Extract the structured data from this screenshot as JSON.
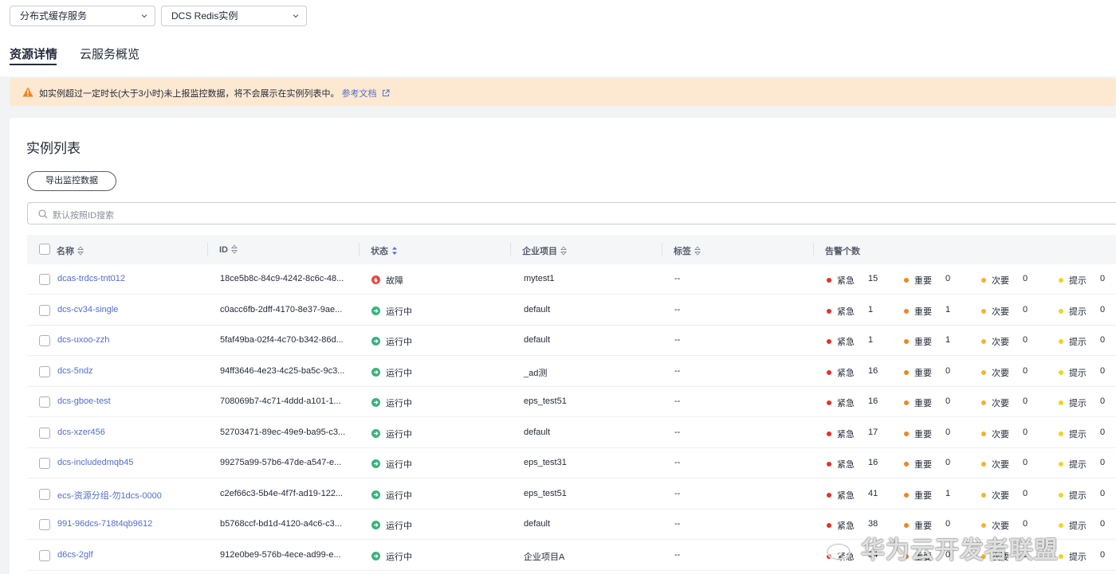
{
  "filters": {
    "service": "分布式缓存服务",
    "resource_type": "DCS Redis实例"
  },
  "tabs": [
    {
      "label": "资源详情",
      "active": true
    },
    {
      "label": "云服务概览",
      "active": false
    }
  ],
  "notice": {
    "text": "如实例超过一定时长(大于3小时)未上报监控数据，将不会展示在实例列表中。",
    "link": "参考文档"
  },
  "panel": {
    "title": "实例列表",
    "export_button": "导出监控数据",
    "search_placeholder": "默认按照ID搜索"
  },
  "table": {
    "columns": {
      "name": "名称",
      "id": "ID",
      "status": "状态",
      "project": "企业项目",
      "tags": "标签",
      "alarms": "告警个数"
    },
    "alarm_labels": {
      "critical": "紧急",
      "major": "重要",
      "minor": "次要",
      "info": "提示"
    },
    "rows": [
      {
        "name": "dcas-trdcs-tnt012",
        "id": "18ce5b8c-84c9-4242-8c6c-48...",
        "status": "故障",
        "status_kind": "fault",
        "project": "mytest1",
        "tags": "--",
        "critical": "15",
        "major": "0",
        "minor": "0",
        "info": "0"
      },
      {
        "name": "dcs-cv34-single",
        "id": "c0acc6fb-2dff-4170-8e37-9ae...",
        "status": "运行中",
        "status_kind": "running",
        "project": "default",
        "tags": "--",
        "critical": "1",
        "major": "1",
        "minor": "0",
        "info": "0"
      },
      {
        "name": "dcs-uxoo-zzh",
        "id": "5faf49ba-02f4-4c70-b342-86d...",
        "status": "运行中",
        "status_kind": "running",
        "project": "default",
        "tags": "--",
        "critical": "1",
        "major": "1",
        "minor": "0",
        "info": "0"
      },
      {
        "name": "dcs-5ndz",
        "id": "94ff3646-4e23-4c25-ba5c-9c3...",
        "status": "运行中",
        "status_kind": "running",
        "project": "_ad测",
        "tags": "--",
        "critical": "16",
        "major": "0",
        "minor": "0",
        "info": "0"
      },
      {
        "name": "dcs-gboe-test",
        "id": "708069b7-4c71-4ddd-a101-1...",
        "status": "运行中",
        "status_kind": "running",
        "project": "eps_test51",
        "tags": "--",
        "critical": "16",
        "major": "0",
        "minor": "0",
        "info": "0"
      },
      {
        "name": "dcs-xzer456",
        "id": "52703471-89ec-49e9-ba95-c3...",
        "status": "运行中",
        "status_kind": "running",
        "project": "default",
        "tags": "--",
        "critical": "17",
        "major": "0",
        "minor": "0",
        "info": "0"
      },
      {
        "name": "dcs-includedmqb45",
        "id": "99275a99-57b6-47de-a547-e...",
        "status": "运行中",
        "status_kind": "running",
        "project": "eps_test31",
        "tags": "--",
        "critical": "16",
        "major": "0",
        "minor": "0",
        "info": "0"
      },
      {
        "name": "ecs-资源分组-勿1dcs-0000",
        "id": "c2ef66c3-5b4e-4f7f-ad19-122...",
        "status": "运行中",
        "status_kind": "running",
        "project": "eps_test51",
        "tags": "--",
        "critical": "41",
        "major": "1",
        "minor": "0",
        "info": "0"
      },
      {
        "name": "991-96dcs-718t4qb9612",
        "id": "b5768ccf-bd1d-4120-a4c6-c3...",
        "status": "运行中",
        "status_kind": "running",
        "project": "default",
        "tags": "--",
        "critical": "38",
        "major": "0",
        "minor": "0",
        "info": "0"
      },
      {
        "name": "d6cs-2glf",
        "id": "912e0be9-576b-4ece-ad99-e...",
        "status": "运行中",
        "status_kind": "running",
        "project": "企业项目A",
        "tags": "--",
        "critical": "34",
        "major": "0",
        "minor": "0",
        "info": "0"
      }
    ]
  },
  "watermark": "华为云开发者联盟",
  "colors": {
    "link": "#526ecc",
    "running": "#3ab27d",
    "fault": "#e8483f",
    "critical": "#e5312b",
    "major": "#f2851a",
    "minor": "#f2b42c",
    "info": "#f0d51e",
    "notice_bg": "#fde8d1"
  },
  "icons": {
    "dropdown": "chevron-down-icon",
    "warning": "warning-icon",
    "external": "external-link-icon",
    "search": "search-icon",
    "sort": "sort-icon",
    "status_running": "running-status-icon",
    "status_fault": "fault-status-icon"
  }
}
